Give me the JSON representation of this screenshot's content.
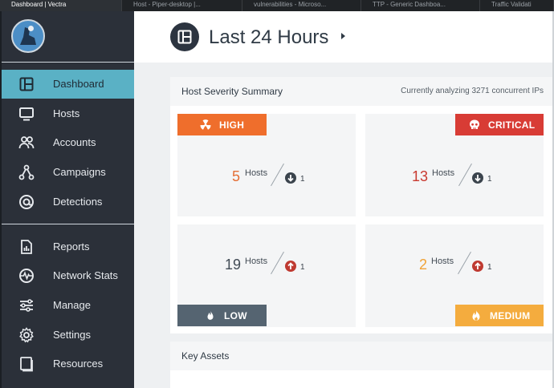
{
  "browser_tabs": [
    {
      "label": "Dashboard | Vectra",
      "active": true
    },
    {
      "label": "Host - Piper-desktop |...",
      "active": false
    },
    {
      "label": "vulnerabilities - Microso...",
      "active": false
    },
    {
      "label": "TTP - Generic Dashboa...",
      "active": false
    },
    {
      "label": "Traffic Validati",
      "active": false
    }
  ],
  "sidebar": {
    "items": [
      {
        "label": "Dashboard",
        "icon": "dashboard-icon",
        "active": true
      },
      {
        "label": "Hosts",
        "icon": "monitor-icon",
        "active": false
      },
      {
        "label": "Accounts",
        "icon": "users-icon",
        "active": false
      },
      {
        "label": "Campaigns",
        "icon": "network-icon",
        "active": false
      },
      {
        "label": "Detections",
        "icon": "at-target-icon",
        "active": false
      },
      {
        "label": "Reports",
        "icon": "report-icon",
        "active": false
      },
      {
        "label": "Network Stats",
        "icon": "heartbeat-icon",
        "active": false
      },
      {
        "label": "Manage",
        "icon": "sliders-icon",
        "active": false
      },
      {
        "label": "Settings",
        "icon": "gear-icon",
        "active": false
      },
      {
        "label": "Resources",
        "icon": "book-icon",
        "active": false
      }
    ]
  },
  "header": {
    "title": "Last 24 Hours"
  },
  "summary": {
    "title": "Host Severity Summary",
    "subtitle": "Currently analyzing 3271 concurrent IPs",
    "hosts_label": "Hosts",
    "cards": {
      "high": {
        "label": "HIGH",
        "count": "5",
        "delta": "1",
        "trend": "down",
        "color": "#ef6e2c"
      },
      "critical": {
        "label": "CRITICAL",
        "count": "13",
        "delta": "1",
        "trend": "down",
        "color": "#d83c35"
      },
      "low": {
        "label": "LOW",
        "count": "19",
        "delta": "1",
        "trend": "up",
        "color": "#556471"
      },
      "medium": {
        "label": "MEDIUM",
        "count": "2",
        "delta": "1",
        "trend": "up",
        "color": "#f4ac3e"
      }
    }
  },
  "key_assets": {
    "title": "Key Assets"
  }
}
